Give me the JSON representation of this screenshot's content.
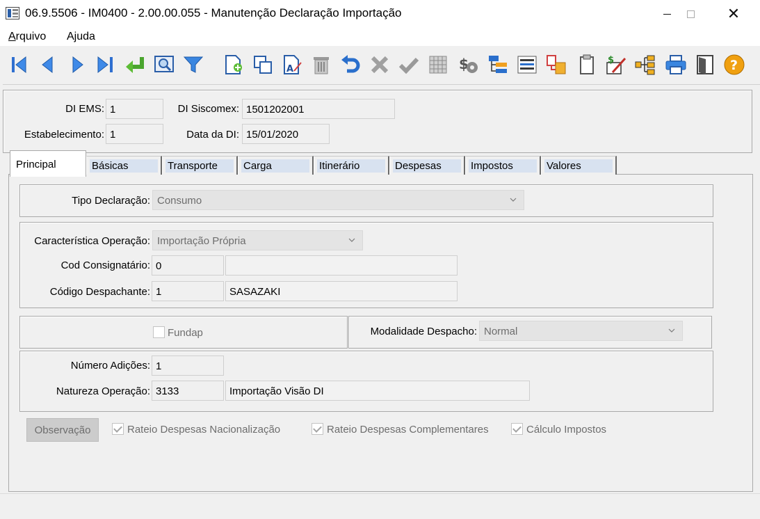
{
  "window": {
    "title": "06.9.5506 - IM0400 - 2.00.00.055 - Manutenção Declaração Importação",
    "close_glyph": "✕"
  },
  "menu": {
    "items": [
      {
        "label": "Arquivo",
        "accel": "A",
        "rest": "rquivo"
      },
      {
        "label": "Ajuda",
        "accel": "j",
        "pre": "A",
        "rest": "uda"
      }
    ]
  },
  "toolbar": {
    "icons": [
      "first-icon",
      "previous-icon",
      "next-icon",
      "last-icon",
      "goto-icon",
      "search-icon",
      "filter-icon",
      "new-icon",
      "copy-icon",
      "edit-icon",
      "delete-icon",
      "undo-icon",
      "cancel-icon",
      "save-icon",
      "calendar-icon",
      "cost-icon",
      "tree-icon",
      "list-icon",
      "transfer-icon",
      "clipboard-icon",
      "note-icon",
      "structure-icon",
      "print-icon",
      "exit-icon",
      "help-icon"
    ]
  },
  "header": {
    "di_ems_label": "DI EMS:",
    "di_ems_value": "1",
    "di_siscomex_label": "DI Siscomex:",
    "di_siscomex_value": "1501202001",
    "estabelecimento_label": "Estabelecimento:",
    "estabelecimento_value": "1",
    "data_di_label": "Data da DI:",
    "data_di_value": "15/01/2020"
  },
  "tabs": [
    "Principal",
    "Básicas",
    "Transporte",
    "Carga",
    "Itinerário",
    "Despesas",
    "Impostos",
    "Valores"
  ],
  "principal": {
    "tipo_declaracao_label": "Tipo Declaração:",
    "tipo_declaracao_value": "Consumo",
    "caracteristica_label": "Característica Operação:",
    "caracteristica_value": "Importação Própria",
    "cod_consignatario_label": "Cod Consignatário:",
    "cod_consignatario_value": "0",
    "cod_consignatario_desc": "",
    "codigo_despachante_label": "Código Despachante:",
    "codigo_despachante_value": "1",
    "codigo_despachante_desc": "SASAZAKI",
    "fundap_label": "Fundap",
    "fundap_checked": false,
    "modalidade_label": "Modalidade Despacho:",
    "modalidade_value": "Normal",
    "numero_adicoes_label": "Número Adições:",
    "numero_adicoes_value": "1",
    "natureza_label": "Natureza Operação:",
    "natureza_value": "3133",
    "natureza_desc": "Importação Visão DI",
    "observacao_label": "Observação",
    "rateio_nac_label": "Rateio Despesas Nacionalização",
    "rateio_comp_label": "Rateio Despesas Complementares",
    "calculo_label": "Cálculo Impostos"
  }
}
